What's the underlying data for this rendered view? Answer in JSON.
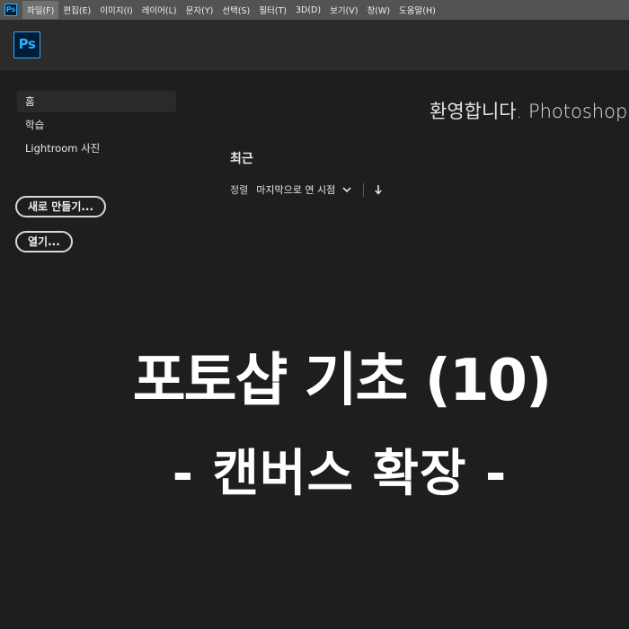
{
  "menubar": {
    "items": [
      "파일(F)",
      "편집(E)",
      "이미지(I)",
      "레이어(L)",
      "문자(Y)",
      "선택(S)",
      "필터(T)",
      "3D(D)",
      "보기(V)",
      "창(W)",
      "도움말(H)"
    ],
    "app_icon": "Ps"
  },
  "header": {
    "logo": "Ps"
  },
  "sidebar": {
    "items": [
      "홈",
      "학습",
      "Lightroom 사진"
    ],
    "new_button": "새로 만들기...",
    "open_button": "열기..."
  },
  "main": {
    "welcome": "환영합니다. Photoshop",
    "recent_title": "최근",
    "sort_label": "정렬",
    "sort_value": "마지막으로 연 시점"
  },
  "overlay": {
    "line1": "포토샵 기초 (10)",
    "line2": "- 캔버스 확장 -"
  },
  "colors": {
    "background": "#1e1e1e",
    "menubar": "#535353",
    "header": "#2b2b2b",
    "ps_blue": "#31a8ff",
    "ps_dark": "#001e36"
  }
}
